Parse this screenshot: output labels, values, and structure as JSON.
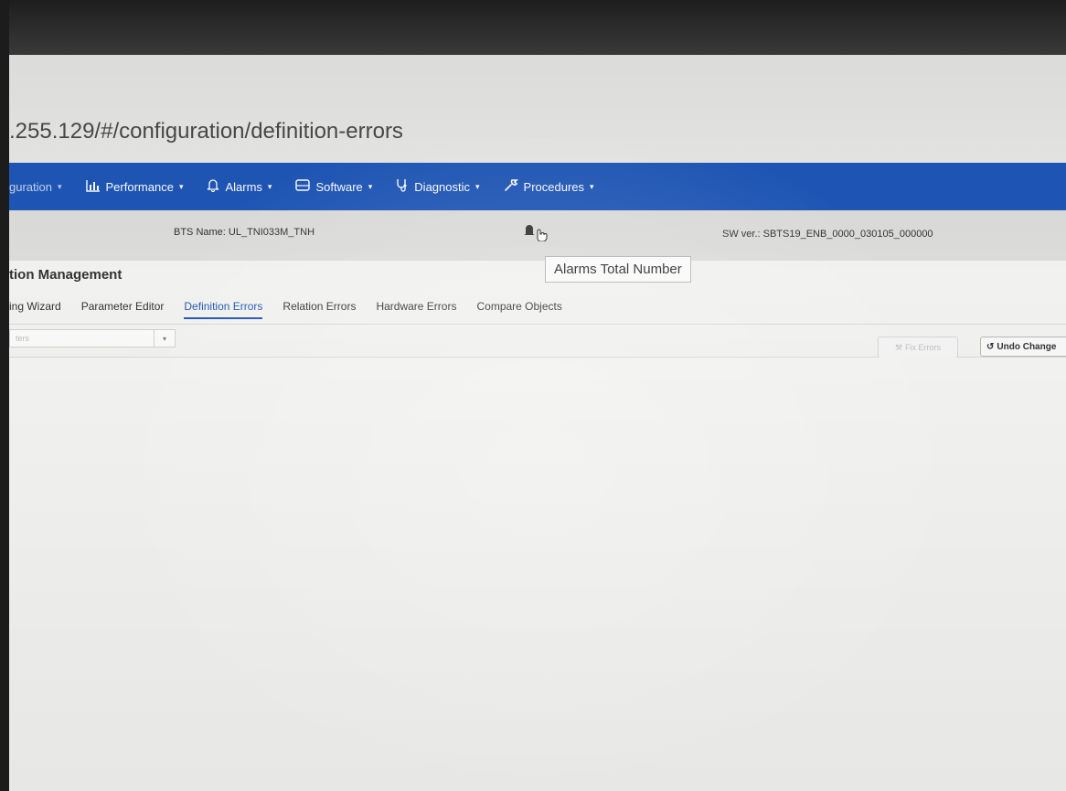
{
  "browser": {
    "url": ".255.129/#/configuration/definition-errors"
  },
  "navbar": {
    "items": [
      {
        "label": "guration",
        "icon": "",
        "caret": "▾"
      },
      {
        "label": "Performance",
        "icon": "bar-chart-icon",
        "caret": "▾"
      },
      {
        "label": "Alarms",
        "icon": "bell-icon",
        "caret": "▾"
      },
      {
        "label": "Software",
        "icon": "hdd-icon",
        "caret": "▾"
      },
      {
        "label": "Diagnostic",
        "icon": "stethoscope-icon",
        "caret": "▾"
      },
      {
        "label": "Procedures",
        "icon": "wrench-icon",
        "caret": "▾"
      }
    ]
  },
  "infobar": {
    "bts_name": "BTS Name: UL_TNI033M_TNH",
    "sw_ver": "SW ver.: SBTS19_ENB_0000_030105_000000",
    "alarm_icon": "bell-icon"
  },
  "tooltip": {
    "text": "Alarms Total Number"
  },
  "page": {
    "title": "tion Management"
  },
  "tabs": [
    {
      "label": "ing Wizard",
      "active": false
    },
    {
      "label": "Parameter Editor",
      "active": false
    },
    {
      "label": "Definition Errors",
      "active": true
    },
    {
      "label": "Relation Errors",
      "active": false
    },
    {
      "label": "Hardware Errors",
      "active": false
    },
    {
      "label": "Compare Objects",
      "active": false
    }
  ],
  "toolbar": {
    "filter_placeholder": "ters",
    "fix_label": "Fix Errors",
    "undo_label": "Undo Change"
  },
  "colors": {
    "navbar": "#1f57b8",
    "active_tab": "#1f57b8"
  }
}
